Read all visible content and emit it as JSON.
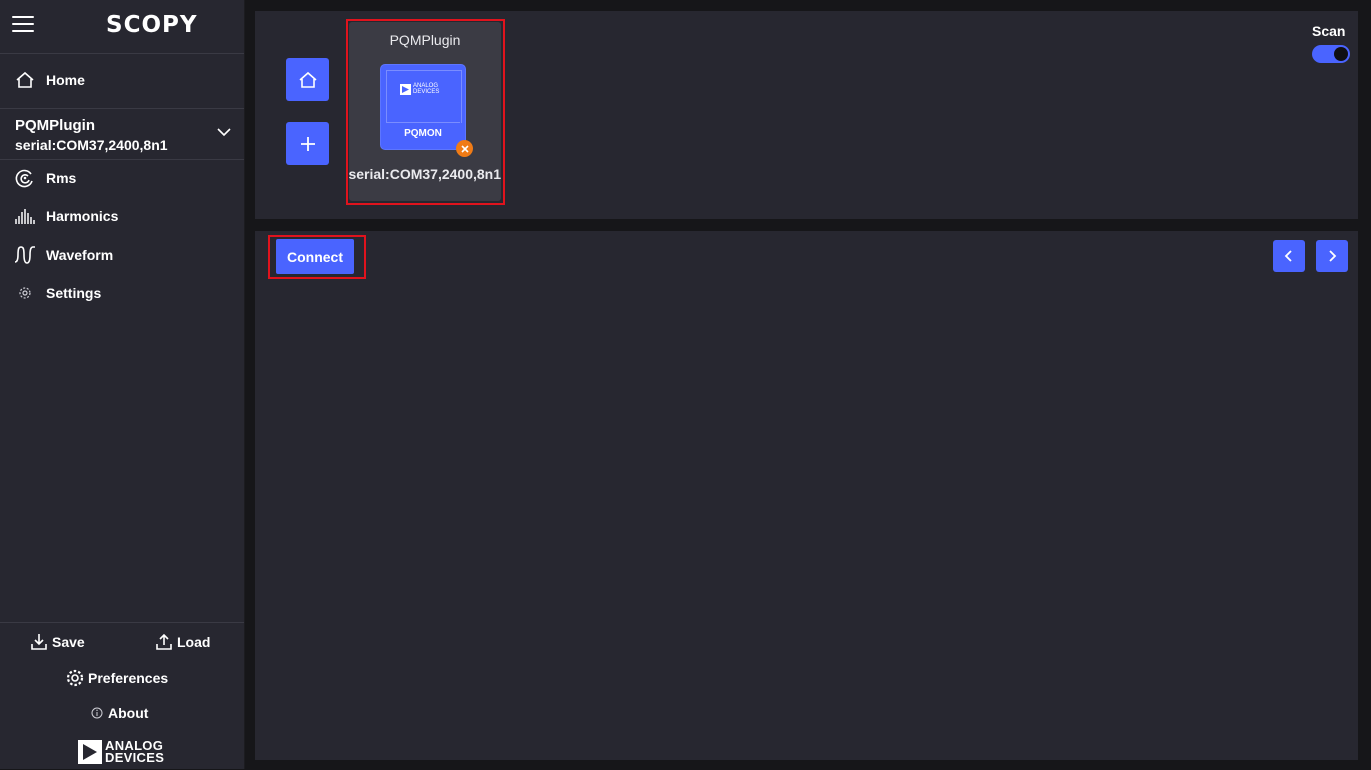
{
  "app": {
    "logo": "SCOPY"
  },
  "sidebar": {
    "home_label": "Home",
    "device": {
      "name": "PQMPlugin",
      "serial": "serial:COM37,2400,8n1"
    },
    "tools": [
      {
        "label": "Rms",
        "icon": "rms-icon"
      },
      {
        "label": "Harmonics",
        "icon": "harmonics-icon"
      },
      {
        "label": "Waveform",
        "icon": "waveform-icon"
      },
      {
        "label": "Settings",
        "icon": "settings-icon"
      }
    ],
    "bottom": {
      "save_label": "Save",
      "load_label": "Load",
      "preferences_label": "Preferences",
      "about_label": "About",
      "brand_line1": "ANALOG",
      "brand_line2": "DEVICES"
    }
  },
  "device_card": {
    "title": "PQMPlugin",
    "chip_label": "PQMON",
    "chip_brand_line1": "ANALOG",
    "chip_brand_line2": "DEVICES",
    "serial": "serial:COM37,2400,8n1"
  },
  "scan": {
    "label": "Scan",
    "enabled": true
  },
  "main": {
    "connect_label": "Connect"
  },
  "colors": {
    "accent": "#4a64ff",
    "background": "#272730",
    "highlight": "#e0131d",
    "warning": "#f07b16"
  }
}
